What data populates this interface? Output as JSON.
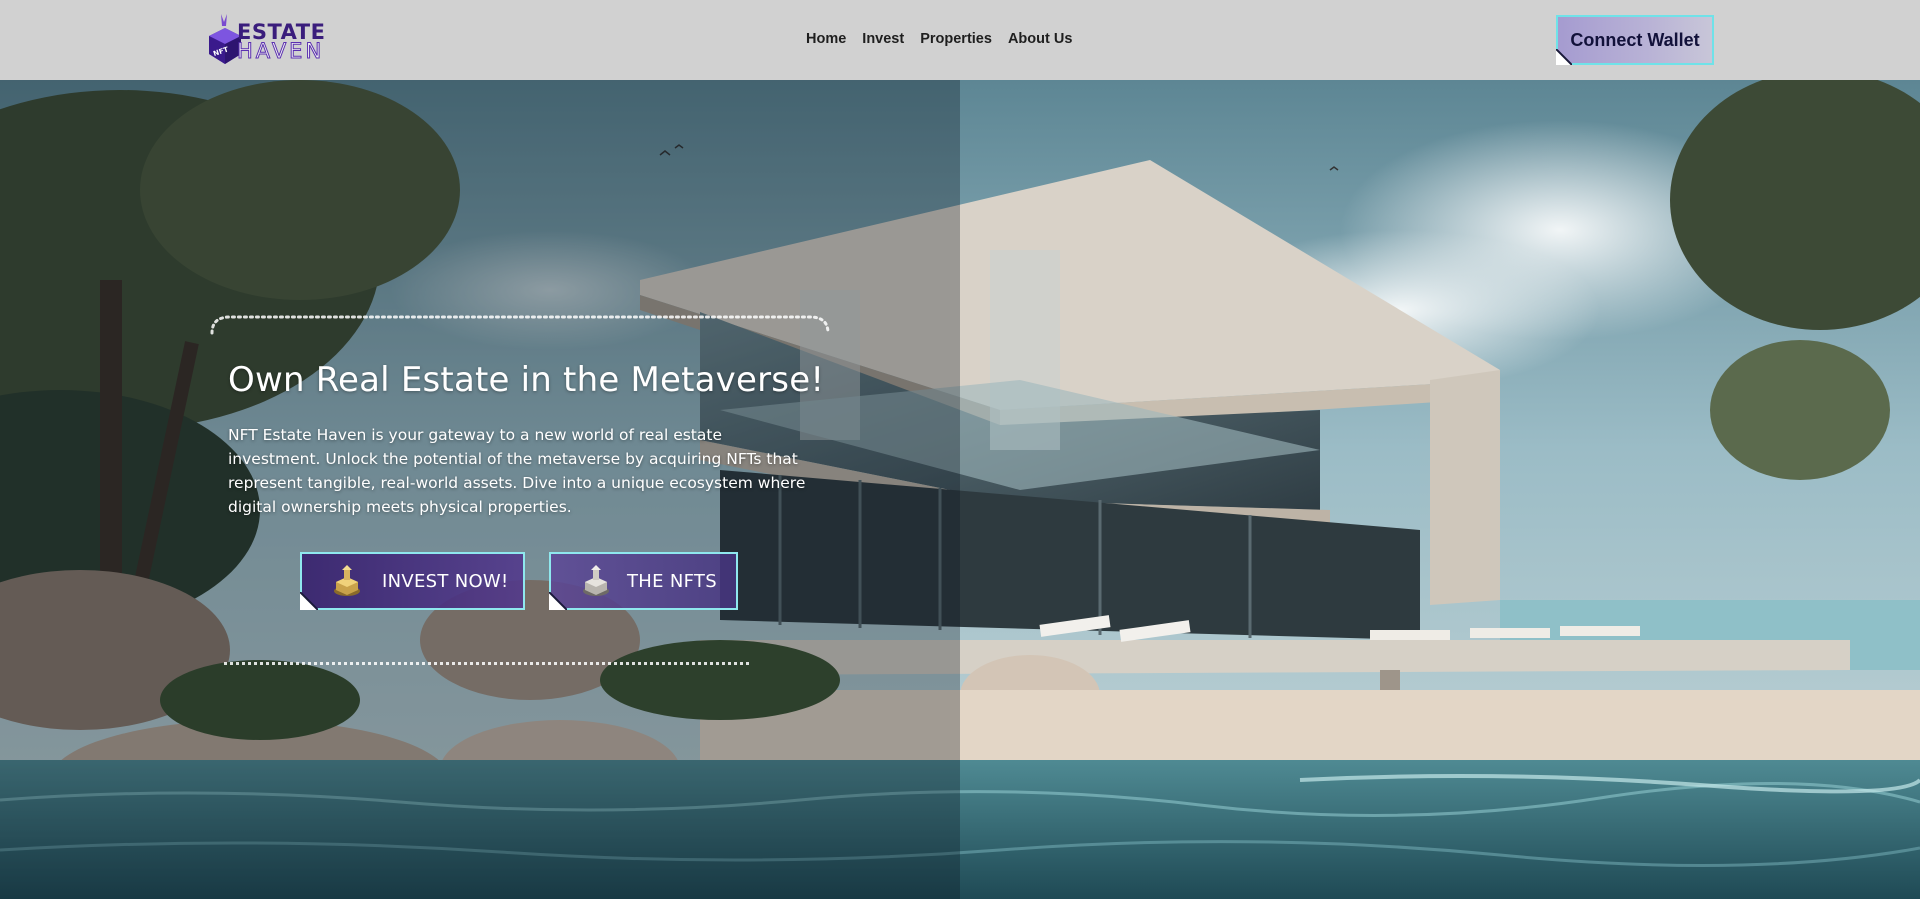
{
  "header": {
    "logo": {
      "word1": "ESTATE",
      "word2": "HAVEN",
      "badge_text": "NFT"
    },
    "nav": [
      {
        "label": "Home"
      },
      {
        "label": "Invest"
      },
      {
        "label": "Properties"
      },
      {
        "label": "About Us"
      }
    ],
    "connect_wallet_label": "Connect Wallet"
  },
  "hero": {
    "title": "Own Real Estate in the Metaverse!",
    "description": "NFT Estate Haven is your gateway to a new world of real estate investment. Unlock the potential of the metaverse by acquiring NFTs that represent tangible, real-world assets. Dive into a unique ecosystem where digital ownership meets physical properties.",
    "buttons": [
      {
        "label": "INVEST NOW!",
        "icon": "gold-property-token-icon"
      },
      {
        "label": "THE NFTS",
        "icon": "silver-property-token-icon"
      }
    ]
  },
  "colors": {
    "header_bg": "#d1d1d1",
    "accent_cyan": "#6fe2e8",
    "brand_purple": "#3a1d7c",
    "button_purple": "#38226e"
  }
}
